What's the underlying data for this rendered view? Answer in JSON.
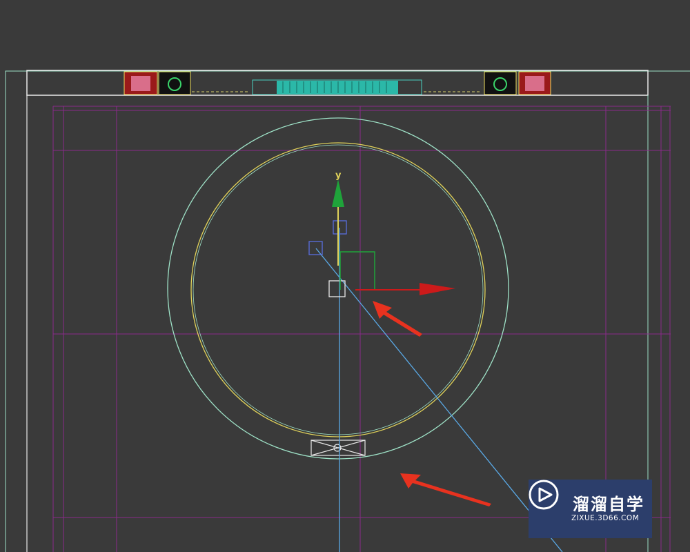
{
  "viewport": {
    "axis_labels": {
      "y": "y"
    }
  },
  "watermark": {
    "title": "溜溜自学",
    "url": "ZIXUE.3D66.COM"
  },
  "colors": {
    "background": "#3a3a3a",
    "circle_outer": "#9fe3c8",
    "circle_inner": "#e1d35a",
    "grid_lines": "#8a2a8a",
    "axis_y": "#1fa33a",
    "axis_x": "#cc1a1a",
    "target_line": "#5aa9e6",
    "annotation_arrow": "#e8321f",
    "watermark_bg": "#2c3e6b"
  },
  "icons": [
    "annotation-arrow-icon",
    "play-logo-icon",
    "gizmo-y-arrow-icon",
    "gizmo-x-arrow-icon"
  ]
}
